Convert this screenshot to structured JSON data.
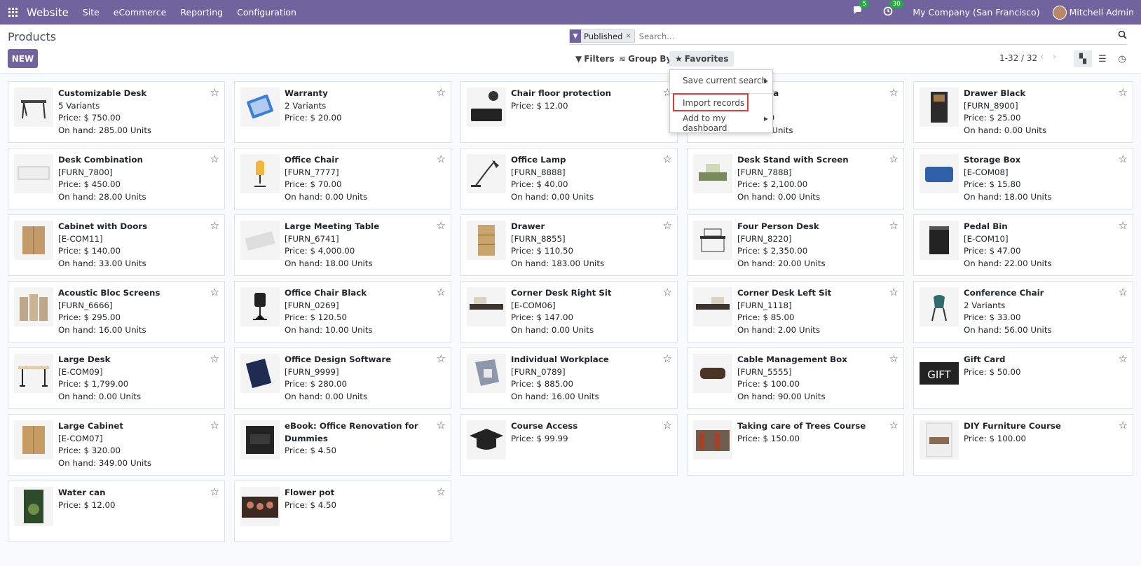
{
  "navbar": {
    "brand": "Website",
    "menu": [
      "Site",
      "eCommerce",
      "Reporting",
      "Configuration"
    ],
    "messages_badge": "5",
    "activity_badge": "30",
    "company": "My Company (San Francisco)",
    "user": "Mitchell Admin",
    "bg_color": "#71639e"
  },
  "control": {
    "title": "Products",
    "new_label": "NEW",
    "facet_label": "Published",
    "facet_remove": "×",
    "search_placeholder": "Search...",
    "filters_label": "Filters",
    "groupby_label": "Group By",
    "favorites_label": "Favorites",
    "pager": "1-32 / 32"
  },
  "favorites_menu": {
    "items": [
      "Save current search",
      "Import records",
      "Add to my dashboard"
    ]
  },
  "products": [
    {
      "name": "Customizable Desk",
      "line2": "5 Variants",
      "price": "Price: $ 750.00",
      "onhand": "On hand: 285.00 Units"
    },
    {
      "name": "Warranty",
      "line2": "2 Variants",
      "price": "Price: $ 20.00",
      "onhand": ""
    },
    {
      "name": "Chair floor protection",
      "line2": "",
      "price": "Price: $ 12.00",
      "onhand": ""
    },
    {
      "name": "…at Sofa",
      "line2": "…999]",
      "price": "…500.00",
      "onhand": "…10.00 Units"
    },
    {
      "name": "Drawer Black",
      "line2": "[FURN_8900]",
      "price": "Price: $ 25.00",
      "onhand": "On hand: 0.00 Units"
    },
    {
      "name": "Desk Combination",
      "line2": "[FURN_7800]",
      "price": "Price: $ 450.00",
      "onhand": "On hand: 28.00 Units"
    },
    {
      "name": "Office Chair",
      "line2": "[FURN_7777]",
      "price": "Price: $ 70.00",
      "onhand": "On hand: 0.00 Units"
    },
    {
      "name": "Office Lamp",
      "line2": "[FURN_8888]",
      "price": "Price: $ 40.00",
      "onhand": "On hand: 0.00 Units"
    },
    {
      "name": "Desk Stand with Screen",
      "line2": "[FURN_7888]",
      "price": "Price: $ 2,100.00",
      "onhand": "On hand: 0.00 Units"
    },
    {
      "name": "Storage Box",
      "line2": "[E-COM08]",
      "price": "Price: $ 15.80",
      "onhand": "On hand: 18.00 Units"
    },
    {
      "name": "Cabinet with Doors",
      "line2": "[E-COM11]",
      "price": "Price: $ 140.00",
      "onhand": "On hand: 33.00 Units"
    },
    {
      "name": "Large Meeting Table",
      "line2": "[FURN_6741]",
      "price": "Price: $ 4,000.00",
      "onhand": "On hand: 18.00 Units"
    },
    {
      "name": "Drawer",
      "line2": "[FURN_8855]",
      "price": "Price: $ 110.50",
      "onhand": "On hand: 183.00 Units"
    },
    {
      "name": "Four Person Desk",
      "line2": "[FURN_8220]",
      "price": "Price: $ 2,350.00",
      "onhand": "On hand: 20.00 Units"
    },
    {
      "name": "Pedal Bin",
      "line2": "[E-COM10]",
      "price": "Price: $ 47.00",
      "onhand": "On hand: 22.00 Units"
    },
    {
      "name": "Acoustic Bloc Screens",
      "line2": "[FURN_6666]",
      "price": "Price: $ 295.00",
      "onhand": "On hand: 16.00 Units"
    },
    {
      "name": "Office Chair Black",
      "line2": "[FURN_0269]",
      "price": "Price: $ 120.50",
      "onhand": "On hand: 10.00 Units"
    },
    {
      "name": "Corner Desk Right Sit",
      "line2": "[E-COM06]",
      "price": "Price: $ 147.00",
      "onhand": "On hand: 0.00 Units"
    },
    {
      "name": "Corner Desk Left Sit",
      "line2": "[FURN_1118]",
      "price": "Price: $ 85.00",
      "onhand": "On hand: 2.00 Units"
    },
    {
      "name": "Conference Chair",
      "line2": "2 Variants",
      "price": "Price: $ 33.00",
      "onhand": "On hand: 56.00 Units"
    },
    {
      "name": "Large Desk",
      "line2": "[E-COM09]",
      "price": "Price: $ 1,799.00",
      "onhand": "On hand: 0.00 Units"
    },
    {
      "name": "Office Design Software",
      "line2": "[FURN_9999]",
      "price": "Price: $ 280.00",
      "onhand": "On hand: 0.00 Units"
    },
    {
      "name": "Individual Workplace",
      "line2": "[FURN_0789]",
      "price": "Price: $ 885.00",
      "onhand": "On hand: 16.00 Units"
    },
    {
      "name": "Cable Management Box",
      "line2": "[FURN_5555]",
      "price": "Price: $ 100.00",
      "onhand": "On hand: 90.00 Units"
    },
    {
      "name": "Gift Card",
      "line2": "",
      "price": "Price: $ 50.00",
      "onhand": ""
    },
    {
      "name": "Large Cabinet",
      "line2": "[E-COM07]",
      "price": "Price: $ 320.00",
      "onhand": "On hand: 349.00 Units"
    },
    {
      "name": "eBook: Office Renovation for Dummies",
      "line2": "",
      "price": "Price: $ 4.50",
      "onhand": ""
    },
    {
      "name": "Course Access",
      "line2": "",
      "price": "Price: $ 99.99",
      "onhand": ""
    },
    {
      "name": "Taking care of Trees Course",
      "line2": "",
      "price": "Price: $ 150.00",
      "onhand": ""
    },
    {
      "name": "DIY Furniture Course",
      "line2": "",
      "price": "Price: $ 100.00",
      "onhand": ""
    },
    {
      "name": "Water can",
      "line2": "",
      "price": "Price: $ 12.00",
      "onhand": ""
    },
    {
      "name": "Flower pot",
      "line2": "",
      "price": "Price: $ 4.50",
      "onhand": ""
    }
  ],
  "gift_card_text": "GIFT"
}
